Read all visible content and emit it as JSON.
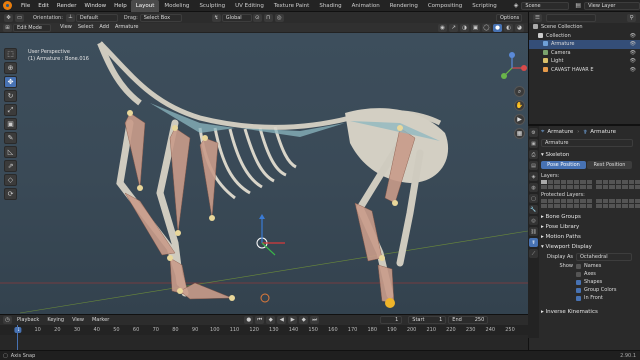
{
  "topbar": {
    "menus": [
      "File",
      "Edit",
      "Render",
      "Window",
      "Help"
    ],
    "tabs": [
      "Layout",
      "Modeling",
      "Sculpting",
      "UV Editing",
      "Texture Paint",
      "Shading",
      "Animation",
      "Rendering",
      "Compositing",
      "Scripting"
    ],
    "active_tab": "Layout",
    "scene": "Scene",
    "view_layer": "View Layer"
  },
  "tool_settings": {
    "orientation_label": "Orientation:",
    "orientation_value": "Default",
    "drag_label": "Drag:",
    "drag_value": "Select Box",
    "transform_orientation": "Global",
    "options_label": "Options"
  },
  "header": {
    "mode": "Edit Mode",
    "menus": [
      "View",
      "Select",
      "Add",
      "Armature"
    ]
  },
  "viewport": {
    "line1": "User Perspective",
    "line2": "(1) Armature : Bone.016"
  },
  "outliner": {
    "items": [
      {
        "label": "Scene Collection",
        "color": "#aaaaaa"
      },
      {
        "label": "Collection",
        "color": "#cccccc"
      },
      {
        "label": "Armature",
        "color": "#6fa0d8"
      },
      {
        "label": "Camera",
        "color": "#7aa36d"
      },
      {
        "label": "Light",
        "color": "#d9c06a"
      },
      {
        "label": "CAVAST HAVAR E",
        "color": "#e69a4a"
      }
    ],
    "selected_index": 2
  },
  "properties": {
    "object_name": "Armature",
    "data_name": "Armature",
    "skeleton_label": "Skeleton",
    "pose_position": "Pose Position",
    "rest_position": "Rest Position",
    "layers_label": "Layers:",
    "protected_layers_label": "Protected Layers:",
    "sections": [
      "Bone Groups",
      "Pose Library",
      "Motion Paths",
      "Viewport Display"
    ],
    "display_as_label": "Display As",
    "display_as_value": "Octahedral",
    "show_label": "Show",
    "show_options": [
      {
        "label": "Names",
        "checked": false
      },
      {
        "label": "Axes",
        "checked": false
      },
      {
        "label": "Shapes",
        "checked": true
      },
      {
        "label": "Group Colors",
        "checked": true
      },
      {
        "label": "In Front",
        "checked": true
      }
    ],
    "footer_section": "Inverse Kinematics"
  },
  "timeline": {
    "menus": [
      "Playback",
      "Keying",
      "View",
      "Marker"
    ],
    "current_frame": "1",
    "start_label": "Start",
    "start_value": "1",
    "end_label": "End",
    "end_value": "250",
    "ruler_ticks": [
      "1",
      "10",
      "20",
      "30",
      "40",
      "50",
      "60",
      "70",
      "80",
      "90",
      "100",
      "110",
      "120",
      "130",
      "140",
      "150",
      "160",
      "170",
      "180",
      "190",
      "200",
      "210",
      "220",
      "230",
      "240",
      "250"
    ]
  },
  "statusbar": {
    "left": "Axis Snap",
    "version": "2.90.1"
  },
  "colors": {
    "accent": "#4772b3",
    "bone": "#c99c8a",
    "skeleton": "#d6d3c8"
  }
}
